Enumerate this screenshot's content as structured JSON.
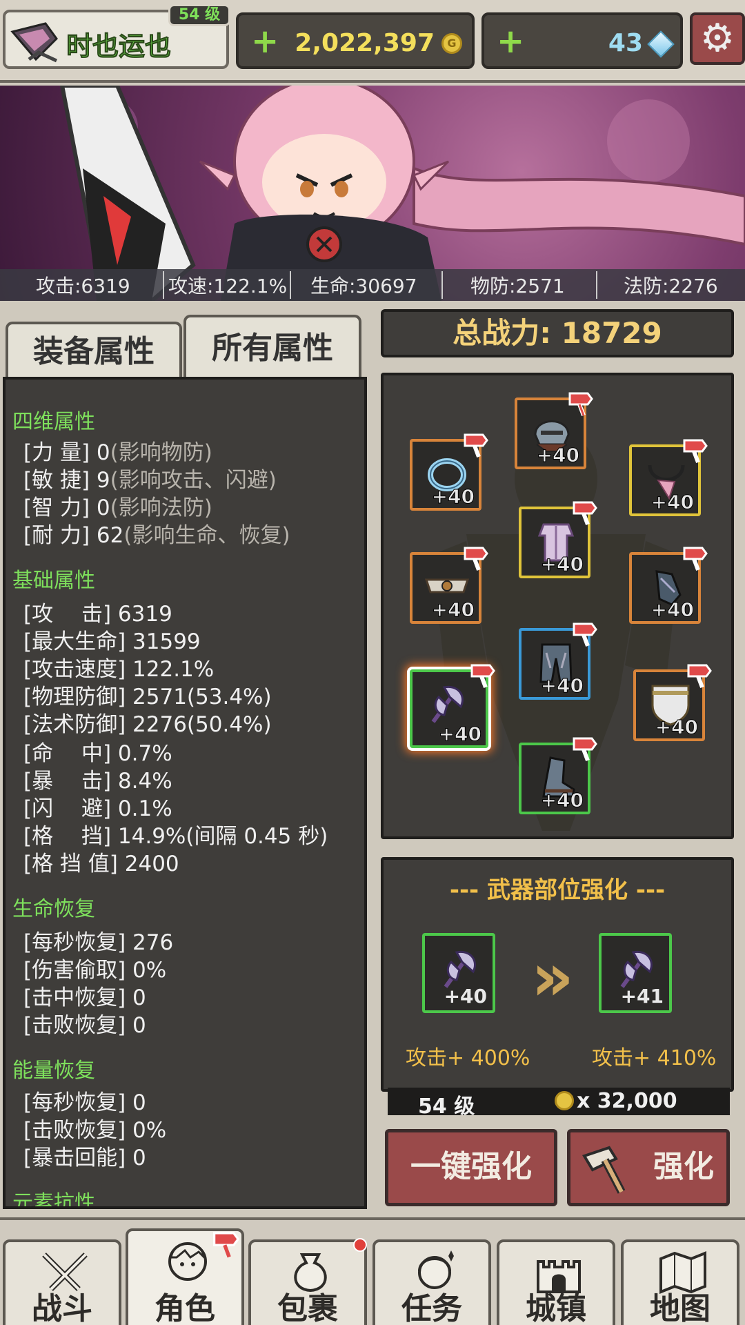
{
  "player": {
    "name": "时也运也",
    "level_badge": "54 级"
  },
  "currency": {
    "gold": "2,022,397",
    "gems": "43"
  },
  "banner_stats": [
    "攻击:6319",
    "攻速:122.1%",
    "生命:30697",
    "物防:2571",
    "法防:2276"
  ],
  "tabs": {
    "equip": "装备属性",
    "all": "所有属性"
  },
  "sections": {
    "four": "四维属性",
    "base": "基础属性",
    "regen": "生命恢复",
    "energy": "能量恢复",
    "element": "元素抗性"
  },
  "four_rows": [
    {
      "label": "[力 量]",
      "value": "0",
      "note": "(影响物防)"
    },
    {
      "label": "[敏 捷]",
      "value": "9",
      "note": "(影响攻击、闪避)"
    },
    {
      "label": "[智 力]",
      "value": "0",
      "note": "(影响法防)"
    },
    {
      "label": "[耐 力]",
      "value": "62",
      "note": "(影响生命、恢复)"
    }
  ],
  "base_rows": [
    "[攻　 击] 6319",
    "[最大生命] 31599",
    "[攻击速度] 122.1%",
    "[物理防御] 2571(53.4%)",
    "[法术防御] 2276(50.4%)",
    "[命　 中] 0.7%",
    "[暴　 击] 8.4%",
    "[闪　 避] 0.1%",
    "[格　 挡] 14.9%(间隔 0.45 秒)",
    "[格 挡 值] 2400"
  ],
  "regen_rows": [
    "[每秒恢复] 276",
    "[伤害偷取] 0%",
    "[击中恢复] 0",
    "[击败恢复] 0"
  ],
  "energy_rows": [
    "[每秒恢复] 0",
    "[击败恢复] 0%",
    "[暴击回能] 0"
  ],
  "power": "总战力: 18729",
  "equip_slots": [
    {
      "name": "helmet",
      "level": "+40",
      "color": "orange"
    },
    {
      "name": "ring",
      "level": "+40",
      "color": "orange"
    },
    {
      "name": "necklace",
      "level": "+40",
      "color": "yellow"
    },
    {
      "name": "armor",
      "level": "+40",
      "color": "yellow"
    },
    {
      "name": "belt",
      "level": "+40",
      "color": "orange"
    },
    {
      "name": "gauntlet",
      "level": "+40",
      "color": "orange"
    },
    {
      "name": "weapon",
      "level": "+40",
      "color": "green"
    },
    {
      "name": "pants",
      "level": "+40",
      "color": "blue"
    },
    {
      "name": "shield",
      "level": "+40",
      "color": "orange"
    },
    {
      "name": "boots",
      "level": "+40",
      "color": "green"
    }
  ],
  "upgrade": {
    "title": "--- 武器部位强化 ---",
    "from_level": "+40",
    "to_level": "+41",
    "from_bonus": "攻击+ 400%",
    "to_bonus": "攻击+ 410%",
    "req_level": "54 级",
    "cost": "x 32,000"
  },
  "buttons": {
    "auto": "一键强化",
    "upgrade": "强化"
  },
  "nav": [
    "战斗",
    "角色",
    "包裹",
    "任务",
    "城镇",
    "地图"
  ]
}
